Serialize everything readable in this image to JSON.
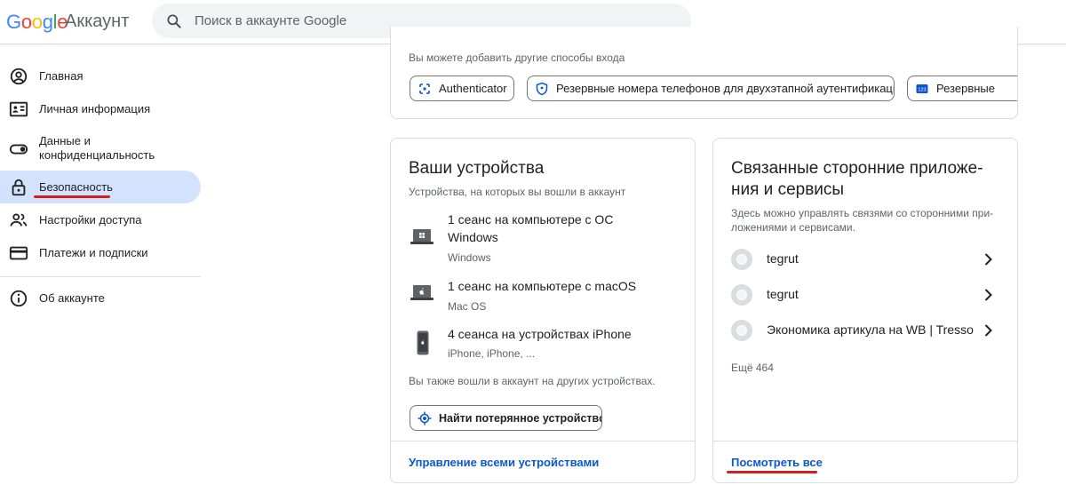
{
  "header": {
    "logo_text": "Google",
    "product_name": "Аккаунт",
    "search_placeholder": "Поиск в аккаунте Google"
  },
  "sidebar": {
    "items": [
      {
        "label": "Главная",
        "icon": "account-circle-icon"
      },
      {
        "label": "Личная информация",
        "icon": "id-card-icon"
      },
      {
        "label": "Данные и конфиденциальность",
        "icon": "toggle-icon"
      },
      {
        "label": "Безопасность",
        "icon": "lock-icon",
        "active": true
      },
      {
        "label": "Настройки доступа",
        "icon": "people-icon"
      },
      {
        "label": "Платежи и подписки",
        "icon": "credit-card-icon"
      },
      {
        "label": "Об аккаунте",
        "icon": "info-icon"
      }
    ]
  },
  "signin_card": {
    "hint": "Вы можете добавить другие способы входа",
    "chips": [
      {
        "label": "Authenticator",
        "icon": "authenticator-icon"
      },
      {
        "label": "Резервные номера телефонов для двухэтапной аутентификации",
        "icon": "shield-icon"
      },
      {
        "label": "Резервные",
        "icon": "backup-codes-icon"
      }
    ]
  },
  "devices_card": {
    "title": "Ваши устройства",
    "subtitle": "Устройства, на которых вы вошли в аккаунт",
    "devices": [
      {
        "title_line1": "1 сеанс на компьютере с ОС",
        "title_line2": "Windows",
        "sub": "Windows",
        "icon": "laptop-windows-icon"
      },
      {
        "title_line1": "1 сеанс на компьютере с macOS",
        "title_line2": "",
        "sub": "Mac OS",
        "icon": "laptop-mac-icon"
      },
      {
        "title_line1": "4 сеанса на устройствах iPhone",
        "title_line2": "",
        "sub": "iPhone, iPhone, ...",
        "icon": "phone-icon"
      }
    ],
    "other_note": "Вы также вошли в аккаунт на других устройствах.",
    "find_button": "Найти потерянное устройство",
    "manage_link": "Управление всеми устройствами"
  },
  "apps_card": {
    "title_line1": "Связанные сторонние приложе-",
    "title_line2": "ния и сервисы",
    "desc_line1": "Здесь можно управлять связями со сторонними при-",
    "desc_line2": "ложениями и сервисами.",
    "apps": [
      {
        "name": "tegrut"
      },
      {
        "name": "tegrut"
      },
      {
        "name": "Экономика артикула на WB | Tresso"
      }
    ],
    "more": "Ещё 464",
    "see_all": "Посмотреть все"
  },
  "colors": {
    "accent": "#0b57d0",
    "active_nav_bg": "#d3e3fd",
    "annotation_red": "#d41f1f"
  }
}
